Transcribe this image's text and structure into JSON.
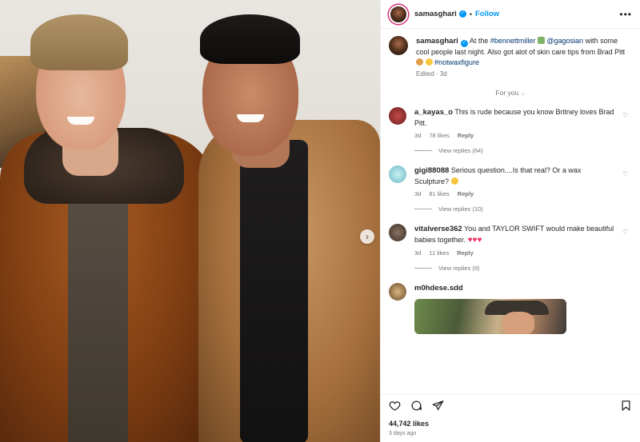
{
  "post": {
    "username": "samasghari",
    "follow_label": "Follow",
    "caption_parts": [
      "At the ",
      "#bennettmiller",
      " ",
      " @gagosian",
      " with some cool people last night. Also got alot of skin care tips from Brad Pitt ",
      " ",
      "#notwaxfigure"
    ],
    "edited_label": "Edited · 3d",
    "likes": "44,742 likes",
    "posted_ago": "3 days ago"
  },
  "comments_filter": "For you",
  "comments": [
    {
      "username": "a_kayas_o",
      "text": "This is rude because you know Britney loves Brad Pitt.",
      "age": "3d",
      "likes": "78 likes",
      "reply_label": "Reply",
      "view_replies": "View replies (64)",
      "avatar_color": "#8a2f2f"
    },
    {
      "username": "gigi88088",
      "text": "Serious question....Is that real? Or a wax Sculpture?",
      "age": "3d",
      "likes": "81 likes",
      "reply_label": "Reply",
      "view_replies": "View replies (10)",
      "avatar_color": "#7fc9d3"
    },
    {
      "username": "vitalverse362",
      "text": "You and TAYLOR SWIFT would make beautiful babies together.",
      "age": "3d",
      "likes": "11 likes",
      "reply_label": "Reply",
      "view_replies": "View replies (9)",
      "avatar_color": "#5b4a3f"
    },
    {
      "username": "m0hdese.sdd",
      "avatar_color": "#b08a5a"
    }
  ],
  "colors": {
    "link": "#00376b",
    "accent": "#0095f6",
    "heart": "#ed2f5f",
    "meta": "#737373"
  },
  "icons": [
    "more-icon",
    "heart-icon",
    "comment-icon",
    "share-icon",
    "bookmark-icon",
    "verified-icon",
    "chevron-right-icon",
    "chevron-down-icon"
  ]
}
